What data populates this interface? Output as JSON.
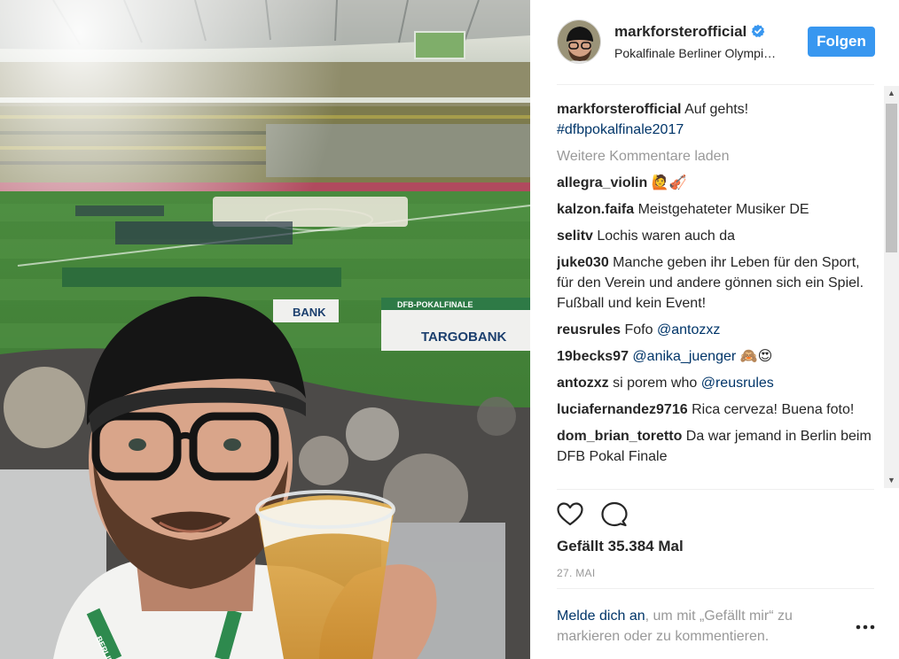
{
  "post": {
    "username": "markforsterofficial",
    "location": "Pokalfinale Berliner Olympi…",
    "follow_label": "Folgen",
    "caption_user": "markforsterofficial",
    "caption_text": "Auf gehts!",
    "caption_hashtag": "#dfbpokalfinale2017",
    "load_more": "Weitere Kommentare laden",
    "likes": "Gefällt 35.384 Mal",
    "date": "27. MAI"
  },
  "comments": [
    {
      "user": "allegra_violin",
      "text": "🙋🎻"
    },
    {
      "user": "kalzon.faifa",
      "text": "Meistgehateter Musiker DE"
    },
    {
      "user": "selitv",
      "text": "Lochis waren auch da"
    },
    {
      "user": "juke030",
      "text": "Manche geben ihr Leben für den Sport, für den Verein und andere gönnen sich ein Spiel. Fußball und kein Event!"
    },
    {
      "user": "reusrules",
      "text": "Fofo",
      "mention": "@antozxz"
    },
    {
      "user": "19becks97",
      "mention": "@anika_juenger",
      "text_after": "🙈😍"
    },
    {
      "user": "antozxz",
      "text": "si porem who",
      "mention": "@reusrules"
    },
    {
      "user": "luciafernandez9716",
      "text": "Rica cerveza! Buena foto!"
    },
    {
      "user": "dom_brian_toretto",
      "text": "Da war jemand in Berlin beim DFB Pokal Finale"
    }
  ],
  "login_prompt": {
    "link": "Melde dich an",
    "rest": ", um mit „Gefällt mir“ zu markieren oder zu kommentieren."
  },
  "photo": {
    "banners": [
      "DFB-POKALFINALE",
      "TARGOBANK",
      "BANK"
    ],
    "lanyard_text": "BERLIN"
  },
  "icons": {
    "verified": "verified-badge-icon",
    "like": "heart-icon",
    "comment": "comment-bubble-icon",
    "more": "more-dots-icon",
    "scroll_up": "scroll-up-arrow-icon",
    "scroll_down": "scroll-down-arrow-icon"
  },
  "colors": {
    "accent": "#3897f0",
    "link": "#003569",
    "muted": "#999999",
    "text": "#262626"
  }
}
